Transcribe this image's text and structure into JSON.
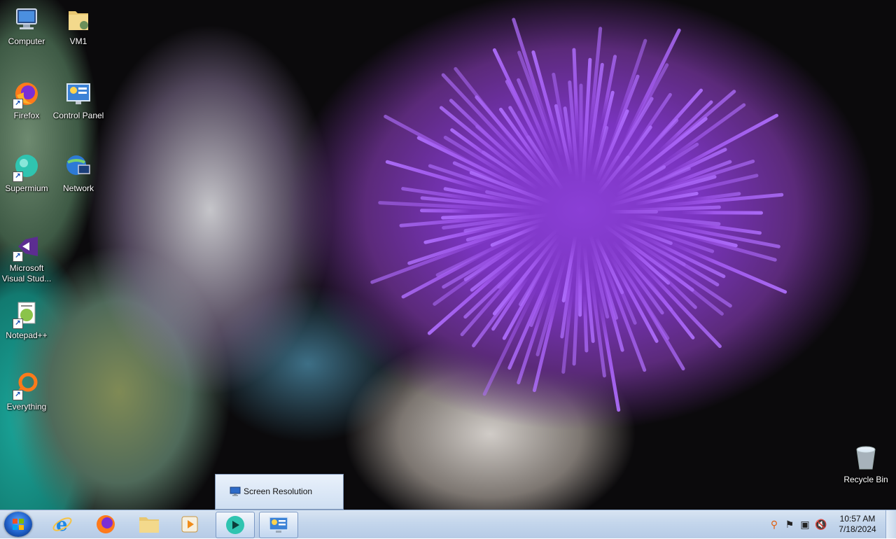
{
  "desktop": {
    "icons": [
      {
        "label": "Computer",
        "icon": "computer-icon"
      },
      {
        "label": "VM1",
        "icon": "folder-icon"
      },
      {
        "label": "Firefox",
        "icon": "firefox-icon"
      },
      {
        "label": "Control Panel",
        "icon": "control-panel-icon"
      },
      {
        "label": "Supermium",
        "icon": "supermium-icon"
      },
      {
        "label": "Network",
        "icon": "network-icon"
      },
      {
        "label": "Microsoft Visual Stud...",
        "icon": "visual-studio-icon"
      },
      {
        "label": "Notepad++",
        "icon": "notepad-plus-plus-icon"
      },
      {
        "label": "Everything",
        "icon": "everything-search-icon"
      },
      {
        "label": "Recycle Bin",
        "icon": "recycle-bin-icon"
      }
    ]
  },
  "taskbar_preview": {
    "label": "Screen Resolution",
    "icon": "screen-resolution-icon"
  },
  "taskbar": {
    "pinned": [
      {
        "name": "internet-explorer",
        "icon": "internet-explorer-icon"
      },
      {
        "name": "firefox",
        "icon": "firefox-icon"
      },
      {
        "name": "file-explorer",
        "icon": "folder-icon"
      },
      {
        "name": "media-player",
        "icon": "media-player-icon"
      },
      {
        "name": "supermium",
        "icon": "supermium-icon"
      },
      {
        "name": "control-panel",
        "icon": "control-panel-icon"
      }
    ],
    "tray": {
      "time": "10:57 AM",
      "date": "7/18/2024"
    }
  },
  "colors": {
    "taskbar_top": "#d8e4f2",
    "taskbar_bottom": "#b6cbe6",
    "flower_purple": "#8a3fd6"
  }
}
